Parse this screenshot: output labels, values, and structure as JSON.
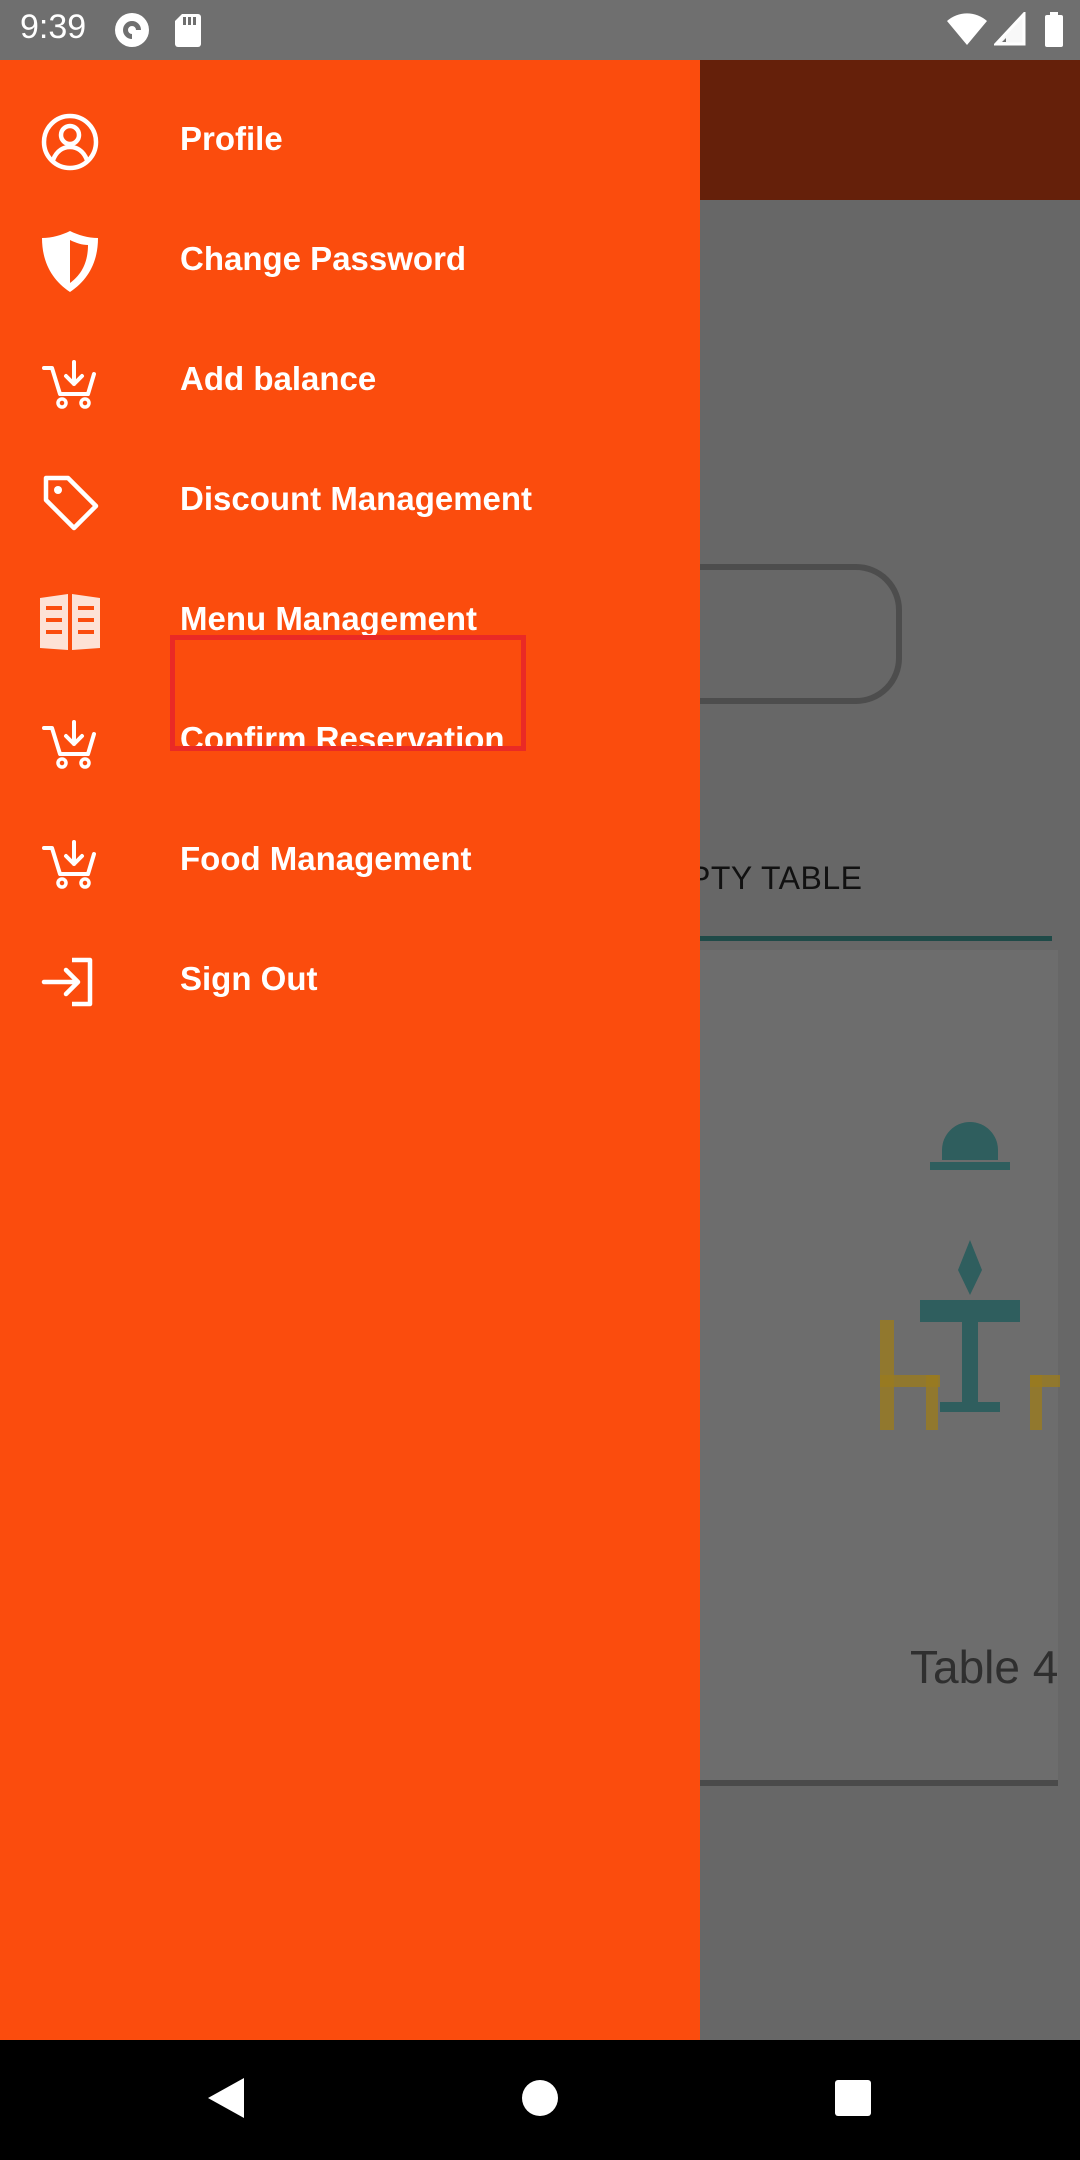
{
  "status_bar": {
    "time": "9:39",
    "icons": [
      "pocket-casts-icon",
      "sd-card-icon",
      "wifi-icon",
      "signal-icon",
      "battery-icon"
    ]
  },
  "background": {
    "tab_label": "EMPTY TABLE",
    "table_label": "Table 4"
  },
  "drawer": {
    "background_color": "#fb4c0d",
    "items": [
      {
        "label": "Profile",
        "icon": "profile-icon"
      },
      {
        "label": "Change Password",
        "icon": "shield-icon"
      },
      {
        "label": "Add balance",
        "icon": "cart-add-icon"
      },
      {
        "label": "Discount Management",
        "icon": "tag-icon"
      },
      {
        "label": "Menu Management",
        "icon": "menu-book-icon"
      },
      {
        "label": "Confirm Reservation",
        "icon": "cart-add-icon"
      },
      {
        "label": "Food Management",
        "icon": "cart-add-icon"
      },
      {
        "label": "Sign Out",
        "icon": "sign-out-icon"
      }
    ],
    "highlighted_item": "Menu Management",
    "highlight_color": "#ea2a25"
  },
  "nav_bar": {
    "buttons": [
      "back-icon",
      "home-icon",
      "recents-icon"
    ]
  }
}
